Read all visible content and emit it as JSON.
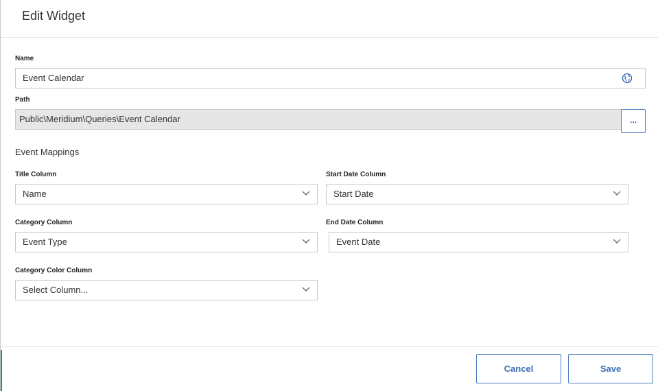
{
  "dialog": {
    "title": "Edit Widget"
  },
  "name_field": {
    "label": "Name",
    "value": "Event Calendar",
    "icon": "globe-icon"
  },
  "path_field": {
    "label": "Path",
    "value": "Public\\Meridium\\Queries\\Event Calendar",
    "browse_label": "..."
  },
  "event_mappings": {
    "section_title": "Event Mappings",
    "title_column": {
      "label": "Title Column",
      "value": "Name"
    },
    "start_date_column": {
      "label": "Start Date Column",
      "value": "Start Date"
    },
    "category_column": {
      "label": "Category Column",
      "value": "Event Type"
    },
    "end_date_column": {
      "label": "End Date Column",
      "value": "Event Date"
    },
    "category_color_column": {
      "label": "Category Color Column",
      "value": "Select Column..."
    }
  },
  "footer": {
    "cancel_label": "Cancel",
    "save_label": "Save"
  },
  "colors": {
    "accent": "#3a6db8",
    "readonly_bg": "#e6e6e6",
    "border": "#c8c8c8"
  }
}
